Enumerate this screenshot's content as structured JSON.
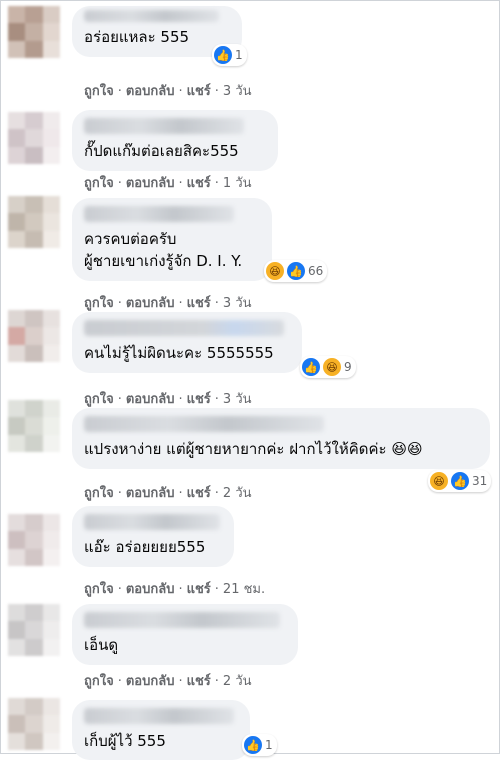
{
  "comments": [
    {
      "text": [
        "อร่อยแหละ 555"
      ],
      "reaction": {
        "icons": [
          "like-icon"
        ],
        "count": "1"
      },
      "time": "3 วัน"
    },
    {
      "text": [
        "กั๊ปดแก๊มต่อเลยสิคะ555"
      ],
      "reaction": null,
      "time": "1 วัน"
    },
    {
      "text": [
        "ควรคบต่อครับ",
        "ผู้ชายเขาเก่งรู้จัก D. I. Y."
      ],
      "reaction": {
        "icons": [
          "haha-icon",
          "like-icon"
        ],
        "count": "66"
      },
      "time": "3 วัน"
    },
    {
      "text": [
        "คนไม่รู้ไม่ผิดนะคะ 5555555"
      ],
      "reaction": {
        "icons": [
          "like-icon",
          "haha-icon"
        ],
        "count": "9"
      },
      "time": "3 วัน"
    },
    {
      "text": [
        "แปรงหาง่าย แต่ผู้ชายหายากค่ะ ฝากไว้ให้คิดค่ะ 😆😆"
      ],
      "reaction": {
        "icons": [
          "haha-icon",
          "like-icon"
        ],
        "count": "31"
      },
      "time": "2 วัน"
    },
    {
      "text": [
        "แอ๊ะ อร่อยยยย555"
      ],
      "reaction": null,
      "time": "21 ชม."
    },
    {
      "text": [
        "เอ็นดู"
      ],
      "reaction": null,
      "time": "2 วัน"
    },
    {
      "text": [
        "เก็บผู้ไว้ 555"
      ],
      "reaction": {
        "icons": [
          "like-icon"
        ],
        "count": "1"
      },
      "time": null
    }
  ],
  "action_labels": {
    "like": "ถูกใจ",
    "reply": "ตอบกลับ",
    "share": "แชร์"
  },
  "colors": {
    "bubble": "#f0f2f5",
    "meta": "#65676b",
    "like": "#1877f2",
    "haha": "#f7b125"
  }
}
